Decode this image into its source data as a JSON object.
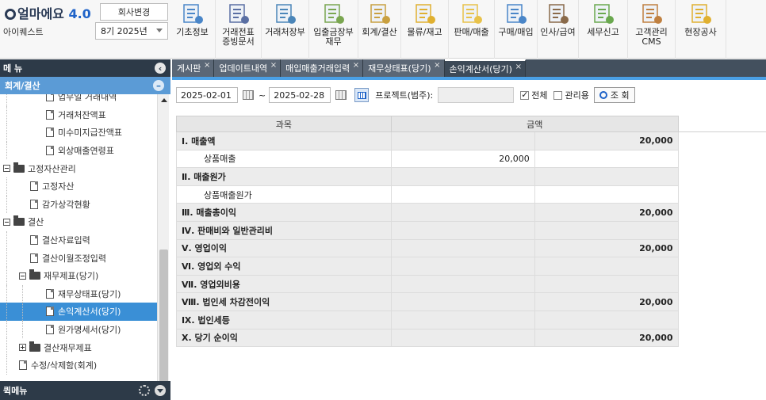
{
  "header": {
    "logo_text": "얼마에요",
    "logo_version": "4.0",
    "company_change_button": "회사변경",
    "company_name": "아이퀘스트",
    "period_select": "8기 2025년"
  },
  "top_menu": [
    {
      "label": "기초정보",
      "label2": "",
      "icon": "basic-info-icon",
      "color": "#4a86c8"
    },
    {
      "label": "거래전표",
      "label2": "증빙문서",
      "icon": "voucher-icon",
      "color": "#5a6fa3"
    },
    {
      "label": "거래처장부",
      "label2": "",
      "icon": "ledger-icon",
      "color": "#4b86b9"
    },
    {
      "label": "입출금장부",
      "label2": "재무",
      "icon": "cashbook-icon",
      "color": "#7aa650"
    },
    {
      "label": "회계/결산",
      "label2": "",
      "icon": "accounting-icon",
      "color": "#c9a040"
    },
    {
      "label": "물류/재고",
      "label2": "",
      "icon": "logistics-icon",
      "color": "#e0b030"
    },
    {
      "label": "판매/매출",
      "label2": "",
      "icon": "sales-icon",
      "color": "#e8c24a"
    },
    {
      "label": "구매/매입",
      "label2": "",
      "icon": "purchase-icon",
      "color": "#4a86c8"
    },
    {
      "label": "인사/급여",
      "label2": "",
      "icon": "hr-payroll-icon",
      "color": "#8a6a4a"
    },
    {
      "label": "세무신고",
      "label2": "",
      "icon": "tax-report-icon",
      "color": "#6aa84f"
    },
    {
      "label": "고객관리",
      "label2": "CMS",
      "icon": "customer-cms-icon",
      "color": "#c08040"
    },
    {
      "label": "현장공사",
      "label2": "",
      "icon": "construction-icon",
      "color": "#e0b030"
    }
  ],
  "sidebar": {
    "header": "메 뉴",
    "section": "회계/결산",
    "items": [
      {
        "label": "업무일 거래내역",
        "kind": "doc",
        "indent": 58,
        "guides": [
          8
        ]
      },
      {
        "label": "거래처잔액표",
        "kind": "doc",
        "indent": 58,
        "guides": [
          8
        ]
      },
      {
        "label": "미수미지급잔액표",
        "kind": "doc",
        "indent": 58,
        "guides": [
          8
        ]
      },
      {
        "label": "외상매출연령표",
        "kind": "doc",
        "indent": 58,
        "guides": [
          8
        ]
      },
      {
        "label": "고정자산관리",
        "kind": "folder-open",
        "indent": 4,
        "guides": []
      },
      {
        "label": "고정자산",
        "kind": "doc",
        "indent": 38,
        "guides": [
          8
        ]
      },
      {
        "label": "감가상각현황",
        "kind": "doc",
        "indent": 38,
        "guides": [
          8
        ]
      },
      {
        "label": "결산",
        "kind": "folder-open",
        "indent": 4,
        "guides": []
      },
      {
        "label": "결산자료입력",
        "kind": "doc",
        "indent": 38,
        "guides": [
          8
        ]
      },
      {
        "label": "결산이월조정입력",
        "kind": "doc",
        "indent": 38,
        "guides": [
          8
        ]
      },
      {
        "label": "재무제표(당기)",
        "kind": "folder-open",
        "indent": 24,
        "guides": [
          8
        ]
      },
      {
        "label": "재무상태표(당기)",
        "kind": "doc",
        "indent": 58,
        "guides": [
          8,
          28
        ]
      },
      {
        "label": "손익계산서(당기)",
        "kind": "doc",
        "indent": 58,
        "guides": [
          8,
          28
        ],
        "selected": true
      },
      {
        "label": "원가명세서(당기)",
        "kind": "doc",
        "indent": 58,
        "guides": [
          8,
          28
        ]
      },
      {
        "label": "결산재무제표",
        "kind": "folder-closed",
        "indent": 24,
        "guides": [
          8
        ]
      },
      {
        "label": "수정/삭제함(회계)",
        "kind": "doc",
        "indent": 24,
        "guides": [
          8
        ]
      }
    ],
    "quick_menu": "퀵메뉴"
  },
  "tabs": [
    {
      "label": "게시판",
      "active": false
    },
    {
      "label": "업데이트내역",
      "active": false
    },
    {
      "label": "매입매출거래입력",
      "active": false
    },
    {
      "label": "재무상태표(당기)",
      "active": false
    },
    {
      "label": "손익계산서(당기)",
      "active": true
    }
  ],
  "filter": {
    "date_from": "2025-02-01",
    "tilde": "~",
    "date_to": "2025-02-28",
    "project_label": "프로젝트(범주):",
    "project_value": "",
    "all_label": "전체",
    "all_checked": true,
    "manage_label": "관리용",
    "manage_checked": false,
    "search_label": "조 회"
  },
  "table": {
    "headers": [
      "과목",
      "금액"
    ],
    "rows": [
      {
        "label": "Ⅰ. 매출액",
        "type": "hd",
        "c1": "",
        "c2": "20,000"
      },
      {
        "label": "상품매출",
        "type": "sub",
        "c1": "20,000",
        "c2": ""
      },
      {
        "label": "Ⅱ. 매출원가",
        "type": "hd",
        "c1": "",
        "c2": ""
      },
      {
        "label": "상품매출원가",
        "type": "sub",
        "c1": "",
        "c2": ""
      },
      {
        "label": "Ⅲ. 매출총이익",
        "type": "hd",
        "c1": "",
        "c2": "20,000"
      },
      {
        "label": "Ⅳ. 판매비와 일반관리비",
        "type": "hd",
        "c1": "",
        "c2": ""
      },
      {
        "label": "Ⅴ. 영업이익",
        "type": "hd",
        "c1": "",
        "c2": "20,000"
      },
      {
        "label": "Ⅵ. 영업외 수익",
        "type": "hd",
        "c1": "",
        "c2": ""
      },
      {
        "label": "Ⅶ. 영업외비용",
        "type": "hd",
        "c1": "",
        "c2": ""
      },
      {
        "label": "Ⅷ. 법인세 차감전이익",
        "type": "hd",
        "c1": "",
        "c2": "20,000"
      },
      {
        "label": "Ⅸ. 법인세등",
        "type": "hd",
        "c1": "",
        "c2": ""
      },
      {
        "label": "Ⅹ. 당기 순이익",
        "type": "hd",
        "c1": "",
        "c2": "20,000"
      }
    ]
  }
}
